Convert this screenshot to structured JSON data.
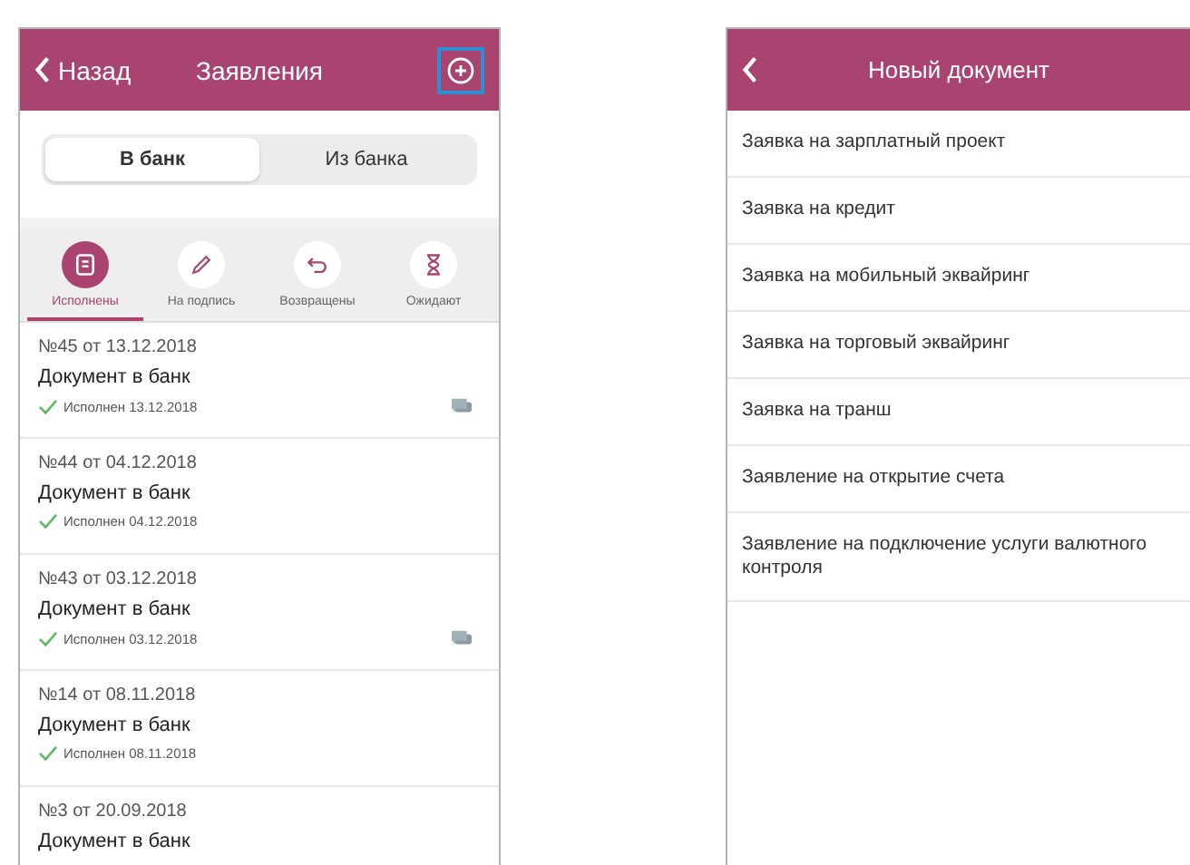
{
  "left_screen": {
    "header": {
      "back": "Назад",
      "title": "Заявления",
      "add_highlighted": true
    },
    "segments": [
      {
        "label": "В банк",
        "selected": true
      },
      {
        "label": "Из банка",
        "selected": false
      }
    ],
    "filters": [
      {
        "label": "Исполнены",
        "kind": "done",
        "selected": true
      },
      {
        "label": "На подпись",
        "kind": "sign",
        "selected": false
      },
      {
        "label": "Возвращены",
        "kind": "returned",
        "selected": false
      },
      {
        "label": "Ожидают",
        "kind": "waiting",
        "selected": false
      }
    ],
    "documents": [
      {
        "number": "№45 от 13.12.2018",
        "title": "Документ в банк",
        "status": "Исполнен 13.12.2018",
        "has_comment": true
      },
      {
        "number": "№44 от 04.12.2018",
        "title": "Документ в банк",
        "status": "Исполнен 04.12.2018",
        "has_comment": false
      },
      {
        "number": "№43 от 03.12.2018",
        "title": "Документ в банк",
        "status": "Исполнен 03.12.2018",
        "has_comment": true
      },
      {
        "number": "№14 от 08.11.2018",
        "title": "Документ в банк",
        "status": "Исполнен 08.11.2018",
        "has_comment": false
      },
      {
        "number": "№3 от 20.09.2018",
        "title": "Документ в банк"
      }
    ]
  },
  "right_screen": {
    "header": {
      "title": "Новый документ"
    },
    "items": [
      "Заявка на зарплатный проект",
      "Заявка на кредит",
      "Заявка на мобильный эквайринг",
      "Заявка на торговый эквайринг",
      "Заявка на транш",
      "Заявление на открытие счета",
      "Заявление на подключение услуги валютного контроля"
    ]
  }
}
